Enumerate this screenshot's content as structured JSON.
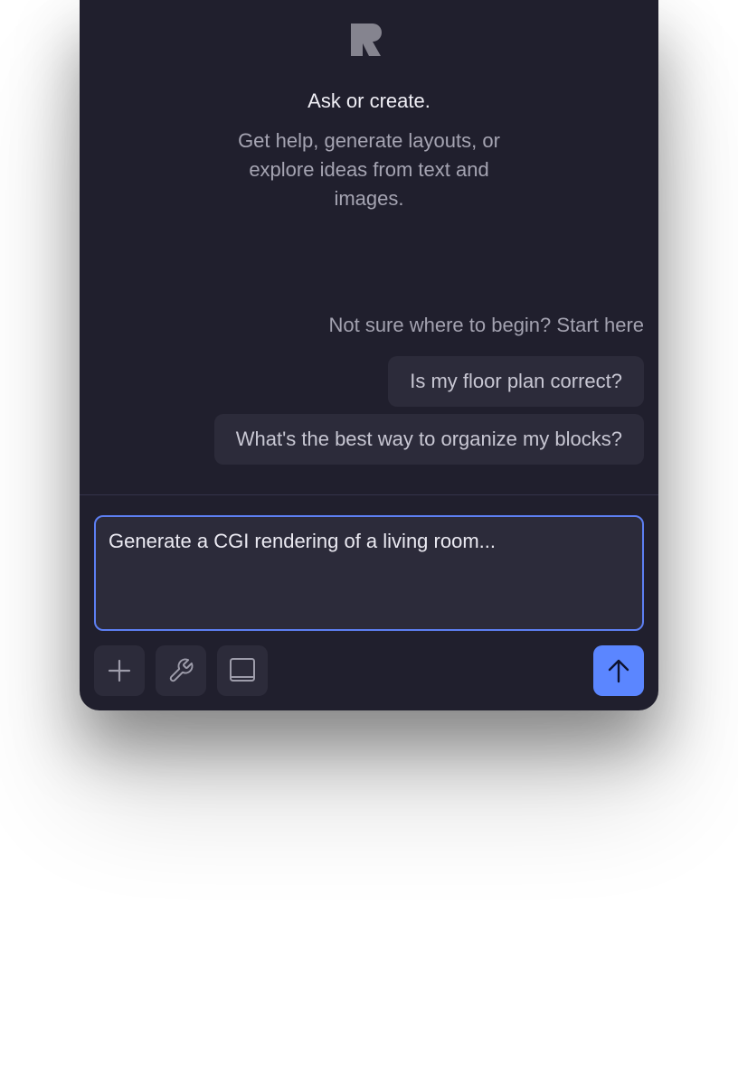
{
  "welcome": {
    "logo_icon": "r-logo-icon",
    "heading": "Ask or create.",
    "subtitle": "Get help, generate layouts, or explore ideas from text and images."
  },
  "suggestions": {
    "hint": "Not sure where to begin? Start here",
    "items": [
      {
        "label": "Is my floor plan correct?"
      },
      {
        "label": "What's the best way to organize my blocks?"
      }
    ]
  },
  "composer": {
    "input_value": "Generate a CGI rendering of a living room...",
    "tools": [
      {
        "icon": "plus-icon"
      },
      {
        "icon": "wrench-icon"
      },
      {
        "icon": "book-icon"
      }
    ],
    "send_icon": "arrow-up-icon"
  },
  "colors": {
    "panel_bg": "#201f2d",
    "surface": "#2c2b3a",
    "accent": "#5b86ff",
    "focus_border": "#5d7ff2"
  }
}
